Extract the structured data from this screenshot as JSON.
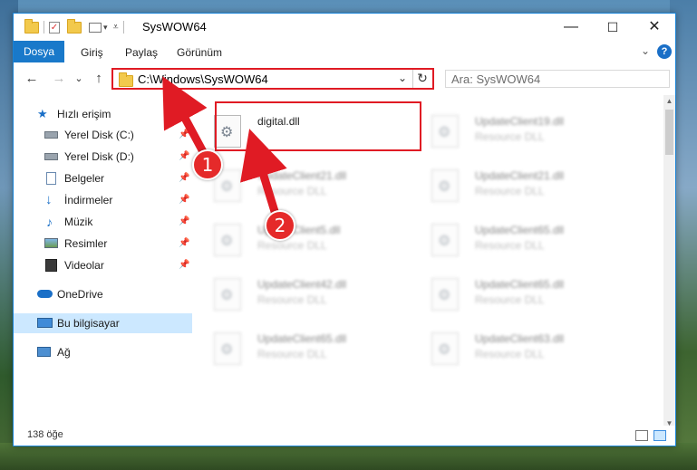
{
  "window": {
    "title": "SysWOW64"
  },
  "window_controls": {
    "minimize": "—",
    "maximize": "☐",
    "close": "✕"
  },
  "ribbon": {
    "tabs": [
      "Dosya",
      "Giriş",
      "Paylaş",
      "Görünüm"
    ],
    "help": "?",
    "collapse": "⌄"
  },
  "navigation": {
    "back": "←",
    "forward": "→",
    "recent": "⌄",
    "up": "↑",
    "address": "C:\\Windows\\SysWOW64",
    "address_dropdown": "⌄",
    "refresh": "↻",
    "search_placeholder": "Ara: SysWOW64"
  },
  "sidebar": {
    "quick_access": "Hızlı erişim",
    "items": [
      {
        "label": "Yerel Disk (C:)",
        "icon": "drive-icon",
        "pinned": true
      },
      {
        "label": "Yerel Disk (D:)",
        "icon": "drive-icon",
        "pinned": true
      },
      {
        "label": "Belgeler",
        "icon": "documents-icon",
        "pinned": true
      },
      {
        "label": "İndirmeler",
        "icon": "download-icon",
        "pinned": true
      },
      {
        "label": "Müzik",
        "icon": "music-icon",
        "pinned": true
      },
      {
        "label": "Resimler",
        "icon": "pictures-icon",
        "pinned": true
      },
      {
        "label": "Videolar",
        "icon": "videos-icon",
        "pinned": true
      }
    ],
    "onedrive": "OneDrive",
    "this_pc": "Bu bilgisayar",
    "network": "Ağ",
    "pin_glyph": "📌"
  },
  "files": [
    {
      "name": "digital.dll",
      "type": ""
    },
    {
      "name": "UpdateClient19.dll",
      "type": "Resource DLL"
    },
    {
      "name": "UpdateClient21.dll",
      "type": "Resource DLL"
    },
    {
      "name": "UpdateClient21.dll",
      "type": "Resource DLL"
    },
    {
      "name": "UpdateClient5.dll",
      "type": "Resource DLL"
    },
    {
      "name": "UpdateClient65.dll",
      "type": "Resource DLL"
    },
    {
      "name": "UpdateClient42.dll",
      "type": "Resource DLL"
    },
    {
      "name": "UpdateClient65.dll",
      "type": "Resource DLL"
    },
    {
      "name": "UpdateClient65.dll",
      "type": "Resource DLL"
    },
    {
      "name": "UpdateClient63.dll",
      "type": "Resource DLL"
    }
  ],
  "status": {
    "count": "138 öğe"
  },
  "annotations": {
    "step1": "1",
    "step2": "2",
    "color": "#e01b24"
  }
}
